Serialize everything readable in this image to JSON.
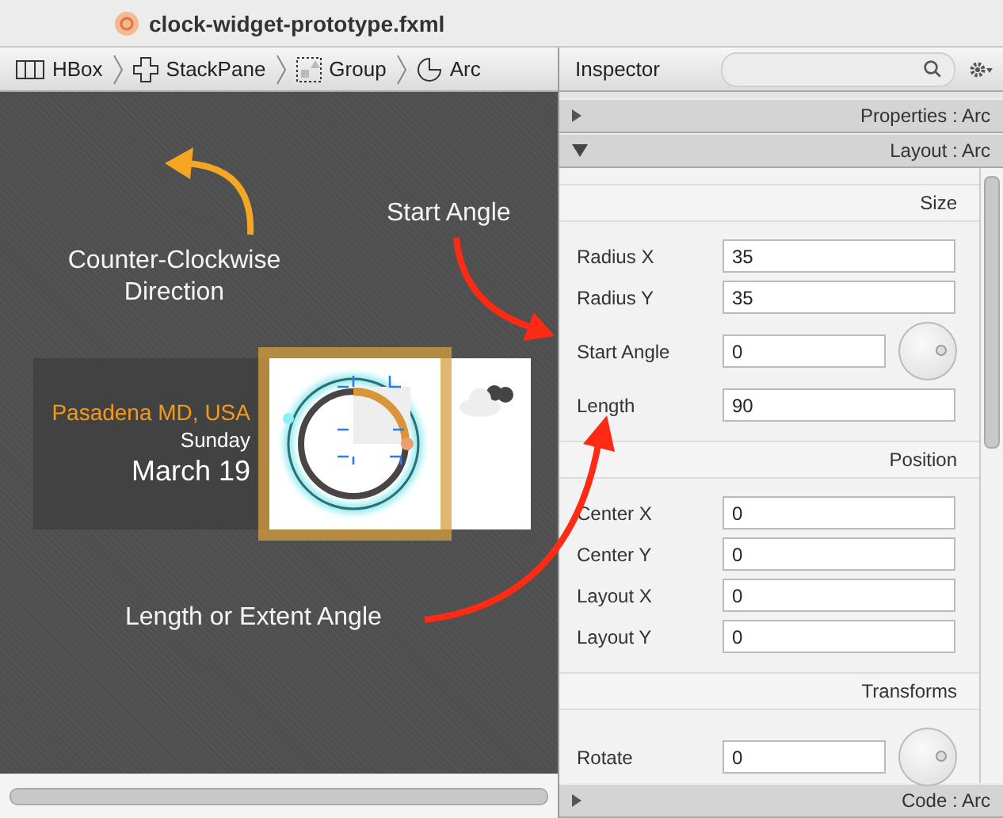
{
  "window": {
    "title": "clock-widget-prototype.fxml"
  },
  "breadcrumb": [
    {
      "label": "HBox",
      "kind": "hbox"
    },
    {
      "label": "StackPane",
      "kind": "stackpane"
    },
    {
      "label": "Group",
      "kind": "group"
    },
    {
      "label": "Arc",
      "kind": "arc"
    }
  ],
  "canvas": {
    "annotations": [
      {
        "kind": "direction",
        "text": "Counter-Clockwise Direction"
      },
      {
        "kind": "start",
        "text": "Start Angle"
      },
      {
        "kind": "length",
        "text": "Length or Extent Angle"
      }
    ],
    "widget": {
      "location": "Pasadena MD, USA",
      "day": "Sunday",
      "date": "March 19",
      "selected": true
    }
  },
  "inspector": {
    "title": "Inspector",
    "sections": [
      {
        "title": "Properties : Arc",
        "expanded": false
      },
      {
        "title": "Layout : Arc",
        "expanded": true,
        "groups": [
          {
            "title": "Size",
            "fields": [
              {
                "label": "Radius X",
                "value": "35",
                "kind": "text"
              },
              {
                "label": "Radius Y",
                "value": "35",
                "kind": "text"
              },
              {
                "label": "Start Angle",
                "value": "0",
                "kind": "angle"
              },
              {
                "label": "Length",
                "value": "90",
                "kind": "text"
              }
            ]
          },
          {
            "title": "Position",
            "fields": [
              {
                "label": "Center X",
                "value": "0",
                "kind": "text"
              },
              {
                "label": "Center Y",
                "value": "0",
                "kind": "text"
              },
              {
                "label": "Layout X",
                "value": "0",
                "kind": "text"
              },
              {
                "label": "Layout Y",
                "value": "0",
                "kind": "text"
              }
            ]
          },
          {
            "title": "Transforms",
            "fields": [
              {
                "label": "Rotate",
                "value": "0",
                "kind": "angle"
              }
            ]
          }
        ]
      },
      {
        "title": "Code : Arc",
        "expanded": false
      }
    ]
  }
}
